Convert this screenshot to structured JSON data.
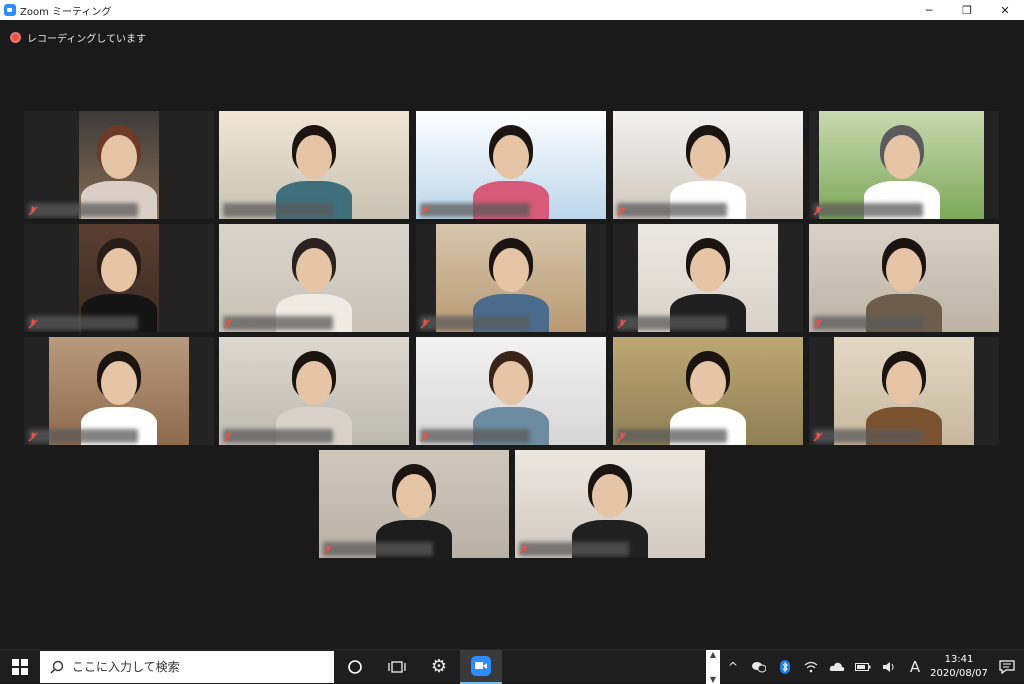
{
  "window": {
    "title": "Zoom ミーティング",
    "minimize": "─",
    "maximize": "❐",
    "close": "✕"
  },
  "recording": {
    "label": "レコーディングしています"
  },
  "participants": [
    {
      "tile": 1,
      "bg": "#8a6f55",
      "cam": "#3b3a3a",
      "hair": "#6b3b2a",
      "shirt": "#d9cfc7"
    },
    {
      "tile": 2,
      "bg": "#c8c2b4",
      "cam": "#efe6d6",
      "hair": "#1b1410",
      "shirt": "#3f6f7a",
      "speaking": true
    },
    {
      "tile": 3,
      "bg": "#bcd6ea",
      "cam": "#ffffff",
      "hair": "#1b1410",
      "shirt": "#d85a7a"
    },
    {
      "tile": 4,
      "bg": "#cfc7bd",
      "cam": "#f2f2f2",
      "hair": "#1b1410",
      "shirt": "#ffffff"
    },
    {
      "tile": 5,
      "bg": "#7ea85a",
      "cam": "#c8d9b0",
      "hair": "#5b5b5b",
      "shirt": "#ffffff"
    },
    {
      "tile": 6,
      "bg": "#3a2a22",
      "cam": "#5a3f33",
      "hair": "#2a1d18",
      "shirt": "#141414"
    },
    {
      "tile": 7,
      "bg": "#c9c2b6",
      "cam": "#d9d4cc",
      "hair": "#2a2220",
      "shirt": "#efeae4"
    },
    {
      "tile": 8,
      "bg": "#b89a73",
      "cam": "#d7c6ad",
      "hair": "#1b1410",
      "shirt": "#4a6b8c"
    },
    {
      "tile": 9,
      "bg": "#d8d2c8",
      "cam": "#ece8e2",
      "hair": "#1b1410",
      "shirt": "#1f1f1f"
    },
    {
      "tile": 10,
      "bg": "#bdb3a7",
      "cam": "#d9d2c7",
      "hair": "#1b1410",
      "shirt": "#6d5d4b"
    },
    {
      "tile": 11,
      "bg": "#8e6a4d",
      "cam": "#b99a7d",
      "hair": "#1b1410",
      "shirt": "#ffffff"
    },
    {
      "tile": 12,
      "bg": "#bdbab2",
      "cam": "#ddd8d0",
      "hair": "#1b1410",
      "shirt": "#d8d2ca"
    },
    {
      "tile": 13,
      "bg": "#d6d6d6",
      "cam": "#f2f2f2",
      "hair": "#3a2418",
      "shirt": "#6e8ca0"
    },
    {
      "tile": 14,
      "bg": "#8f7f55",
      "cam": "#bda874",
      "hair": "#1b1410",
      "shirt": "#ffffff"
    },
    {
      "tile": 15,
      "bg": "#c6b89e",
      "cam": "#e4d9c6",
      "hair": "#1b1410",
      "shirt": "#7a5230"
    },
    {
      "tile": 16,
      "bg": "#b9b1a6",
      "cam": "#cfc8bd",
      "hair": "#1b1410",
      "shirt": "#1c1c1c"
    },
    {
      "tile": 17,
      "bg": "#cfc9c1",
      "cam": "#ece7e0",
      "hair": "#1b1410",
      "shirt": "#202020"
    }
  ],
  "taskbar": {
    "search_placeholder": "ここに入力して検索",
    "time": "13:41",
    "date": "2020/08/07",
    "ime": "A"
  },
  "colors": {
    "speaking_border": "#c9d94a",
    "recording_dot": "#e5534b",
    "zoom_blue": "#2d8cff"
  }
}
